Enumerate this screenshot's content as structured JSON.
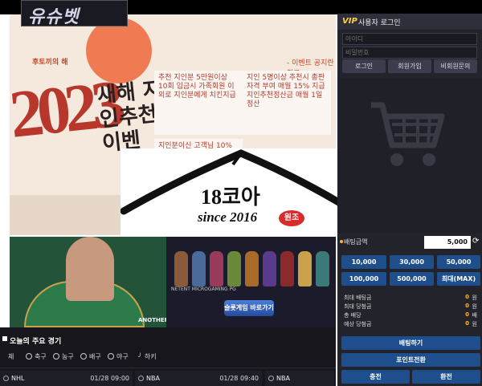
{
  "logo": {
    "text": "유슈벳"
  },
  "banner": {
    "tag": "후토끼의 해",
    "year": "2023",
    "headline": "새해 지인추천 이벤",
    "event_ref": "- 이벤트 공지란 참고 -",
    "cards": [
      "추천 지인분 5만원이상 10회 입금시 가족회원 이외로 지인분에게 치킨지급",
      "지인 5명이상 추천시 총판자격 부여 매월 15% 지급 지인추천정산금 매월 1일 정산",
      "지인분이신 고객님 10%"
    ]
  },
  "overlay_logo": {
    "name": "18코아",
    "since": "since 2016",
    "seal": "원조"
  },
  "casino": {
    "table_label": "ANOTHERLV",
    "providers": "NETENT  MICROGAMING  PG",
    "slot_button": "슬롯게임 바로가기"
  },
  "games": {
    "title": "오늘의 주요 경기",
    "tabs": [
      "체",
      "축구",
      "농구",
      "배구",
      "야구",
      "하키"
    ],
    "matches": [
      {
        "league": "NHL",
        "time": "01/28 09:00"
      },
      {
        "league": "NBA",
        "time": "01/28 09:40"
      },
      {
        "league": "NBA",
        "time": ""
      }
    ]
  },
  "sidebar": {
    "vip": "VIP",
    "login_title": "사용자 로그인",
    "id_placeholder": "아이디",
    "pw_placeholder": "비밀번호",
    "buttons": [
      "로그인",
      "회원가입",
      "비회원문의"
    ],
    "bet_amount_label": "배팅금액",
    "bet_amount_value": "5,000",
    "chips": [
      "10,000",
      "30,000",
      "50,000",
      "100,000",
      "500,000",
      "최대(MAX)"
    ],
    "stats": [
      {
        "label": "최대 배팅금",
        "value": "0",
        "unit": "원"
      },
      {
        "label": "최대 당첨금",
        "value": "0",
        "unit": "원"
      },
      {
        "label": "총 배당",
        "value": "0",
        "unit": "배"
      },
      {
        "label": "예상 당첨금",
        "value": "0",
        "unit": "원"
      }
    ],
    "bet_button": "배팅하기",
    "point_button": "포인트전환",
    "deposit_button": "충전",
    "withdraw_button": "환전"
  },
  "colors": {
    "accent_blue": "#1e4f8c",
    "sidebar_bg": "#23232c",
    "highlight": "#ffb42a"
  }
}
